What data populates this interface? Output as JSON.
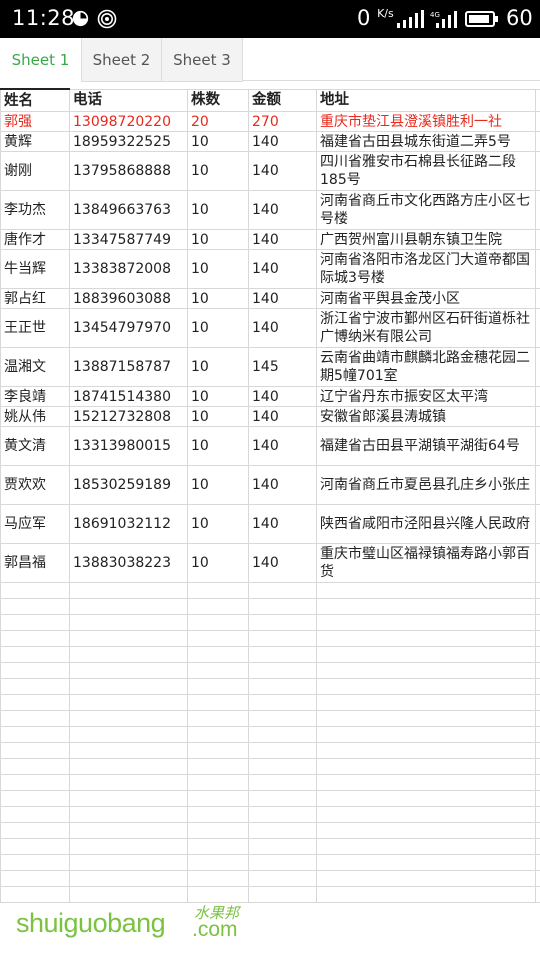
{
  "status_bar": {
    "time": "11:28",
    "net_speed": "0",
    "net_speed_unit": "K/s",
    "network_type": "4G",
    "battery_percent": "60",
    "icons": [
      "half-circle-icon",
      "wifi-hotspot-icon",
      "signal-bars-icon",
      "signal-4g-icon",
      "battery-icon"
    ]
  },
  "tabs": [
    {
      "label": "Sheet 1",
      "active": true
    },
    {
      "label": "Sheet 2",
      "active": false
    },
    {
      "label": "Sheet 3",
      "active": false
    }
  ],
  "sheet": {
    "headers": [
      "姓名",
      "电话",
      "株数",
      "金额",
      "地址"
    ],
    "rows": [
      {
        "name": "郭强",
        "phone": "13098720220",
        "count": "20",
        "amount": "270",
        "address": "重庆市垫江县澄溪镇胜利一社",
        "highlight": true
      },
      {
        "name": "黄辉",
        "phone": "18959322525",
        "count": "10",
        "amount": "140",
        "address": "福建省古田县城东街道二弄5号"
      },
      {
        "name": "谢刚",
        "phone": "13795868888",
        "count": "10",
        "amount": "140",
        "address": "四川省雅安市石棉县长征路二段185号"
      },
      {
        "name": "李功杰",
        "phone": "13849663763",
        "count": "10",
        "amount": "140",
        "address": "河南省商丘市文化西路方庄小区七号楼"
      },
      {
        "name": "唐作才",
        "phone": "13347587749",
        "count": "10",
        "amount": "140",
        "address": "广西贺州富川县朝东镇卫生院"
      },
      {
        "name": "牛当辉",
        "phone": "13383872008",
        "count": "10",
        "amount": "140",
        "address": "河南省洛阳市洛龙区门大道帝都国际城3号楼"
      },
      {
        "name": "郭占红",
        "phone": "18839603088",
        "count": "10",
        "amount": "140",
        "address": "河南省平舆县金茂小区"
      },
      {
        "name": "王正世",
        "phone": "13454797970",
        "count": "10",
        "amount": "140",
        "address": "浙江省宁波市鄞州区石矸街道栎社广博纳米有限公司"
      },
      {
        "name": "温湘文",
        "phone": "13887158787",
        "count": "10",
        "amount": "145",
        "address": "云南省曲靖市麒麟北路金穗花园二期5幢701室"
      },
      {
        "name": "李良靖",
        "phone": "18741514380",
        "count": "10",
        "amount": "140",
        "address": "辽宁省丹东市振安区太平湾"
      },
      {
        "name": "姚从伟",
        "phone": "15212732808",
        "count": "10",
        "amount": "140",
        "address": "安徽省郎溪县涛城镇"
      },
      {
        "name": "黄文清",
        "phone": "13313980015",
        "count": "10",
        "amount": "140",
        "address": "福建省古田县平湖镇平湖街64号"
      },
      {
        "name": "贾欢欢",
        "phone": "18530259189",
        "count": "10",
        "amount": "140",
        "address": "河南省商丘市夏邑县孔庄乡小张庄"
      },
      {
        "name": "马应军",
        "phone": "18691032112",
        "count": "10",
        "amount": "140",
        "address": "陕西省咸阳市泾阳县兴隆人民政府"
      },
      {
        "name": "郭昌福",
        "phone": "13883038223",
        "count": "10",
        "amount": "140",
        "address": "重庆市璧山区福禄镇福寿路小郭百货"
      }
    ]
  },
  "watermark": {
    "main": "shuiguobang",
    "chinese": "水果邦",
    "suffix": ".com"
  },
  "colors": {
    "active_tab": "#3aa84a",
    "highlight_row": "#e8291e",
    "watermark": "#7bc241"
  }
}
